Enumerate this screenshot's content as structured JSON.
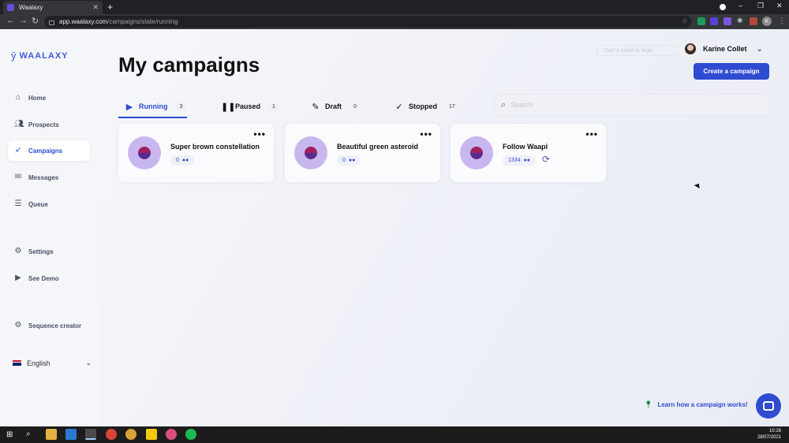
{
  "browser": {
    "tab_title": "Waalaxy",
    "tab_close": "✕",
    "new_tab": "+",
    "url_host": "app.waalaxy.com",
    "url_path": "/campaigns/state/running",
    "profile_initial": "K",
    "minimize": "–",
    "restore": "❐",
    "close": "✕"
  },
  "sidebar": {
    "logo": "WAALAXY",
    "items": [
      {
        "label": "Home",
        "icon": "home-icon"
      },
      {
        "label": "Prospects",
        "icon": "people-icon"
      },
      {
        "label": "Campaigns",
        "icon": "rocket-icon"
      },
      {
        "label": "Messages",
        "icon": "envelope-icon"
      },
      {
        "label": "Queue",
        "icon": "list-icon"
      },
      {
        "label": "Settings",
        "icon": "gear-icon"
      },
      {
        "label": "See Demo",
        "icon": "play-icon"
      },
      {
        "label": "Sequence creator",
        "icon": "gear-icon"
      }
    ],
    "language": "English"
  },
  "header": {
    "title": "My campaigns",
    "login_placeholder": "User's email to login",
    "user_name": "Karine Collet",
    "create_button": "Create a campaign"
  },
  "tabs": [
    {
      "label": "Running",
      "count": "3",
      "icon": "play-icon"
    },
    {
      "label": "Paused",
      "count": "1",
      "icon": "pause-icon"
    },
    {
      "label": "Draft",
      "count": "0",
      "icon": "pencil-icon"
    },
    {
      "label": "Stopped",
      "count": "17",
      "icon": "check-icon"
    }
  ],
  "search": {
    "placeholder": "Search"
  },
  "campaigns": [
    {
      "name": "Super brown constellation",
      "prospects": "0"
    },
    {
      "name": "Beautiful green asteroid",
      "prospects": "0"
    },
    {
      "name": "Follow Waapi",
      "prospects": "1334"
    }
  ],
  "footer": {
    "learn_link": "Learn how a campaign works!"
  },
  "taskbar": {
    "time": "10:28",
    "date": "28/07/2021"
  },
  "colors": {
    "accent": "#2e4bd1",
    "sidebar_bg": "#f5f6fa",
    "avatar_bg": "#c8b7ef"
  }
}
